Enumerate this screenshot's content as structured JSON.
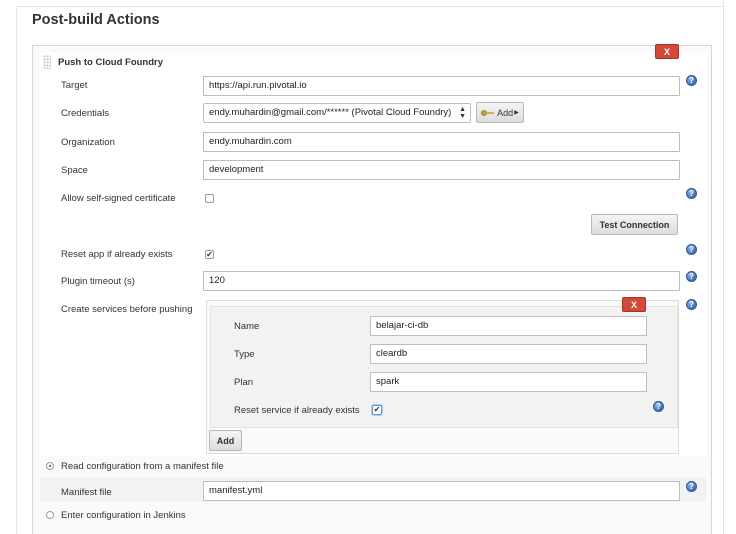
{
  "section": {
    "title": "Post-build Actions"
  },
  "step": {
    "title": "Push to Cloud Foundry",
    "delete_label": "X",
    "fields": {
      "target": {
        "label": "Target",
        "value": "https://api.run.pivotal.io"
      },
      "credentials": {
        "label": "Credentials",
        "selected": "endy.muhardin@gmail.com/****** (Pivotal Cloud Foundry)",
        "add_label": "Add"
      },
      "organization": {
        "label": "Organization",
        "value": "endy.muhardin.com"
      },
      "space": {
        "label": "Space",
        "value": "development"
      },
      "self_signed": {
        "label": "Allow self-signed certificate",
        "checked": false
      },
      "test_connection": {
        "label": "Test Connection"
      },
      "reset_app": {
        "label": "Reset app if already exists",
        "checked": true
      },
      "plugin_timeout": {
        "label": "Plugin timeout (s)",
        "value": "120"
      },
      "create_services": {
        "label": "Create services before pushing"
      }
    },
    "service": {
      "delete_label": "X",
      "name": {
        "label": "Name",
        "value": "belajar-ci-db"
      },
      "type": {
        "label": "Type",
        "value": "cleardb"
      },
      "plan": {
        "label": "Plan",
        "value": "spark"
      },
      "reset": {
        "label": "Reset service if already exists",
        "checked": true
      },
      "add_label": "Add"
    },
    "manifest": {
      "option_manifest": "Read configuration from a manifest file",
      "file_label": "Manifest file",
      "file_value": "manifest.yml",
      "option_jenkins": "Enter configuration in Jenkins",
      "selected": "manifest"
    }
  },
  "icons": {
    "help": "?",
    "check": "✔",
    "select_arrows": "▲▼",
    "key": "key-icon"
  },
  "colors": {
    "delete": "#d24939",
    "help": "#3d6fb6"
  }
}
